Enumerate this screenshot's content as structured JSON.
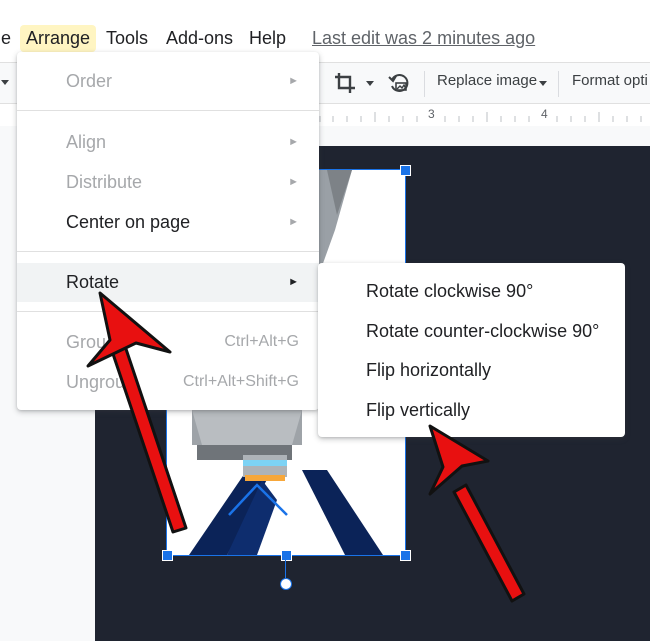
{
  "menubar": {
    "partial_item": "e",
    "items": [
      "Arrange",
      "Tools",
      "Add-ons",
      "Help"
    ],
    "last_edit": "Last edit was 2 minutes ago"
  },
  "toolbar": {
    "replace_image": "Replace image",
    "format_options": "Format opti"
  },
  "ruler": {
    "marks": [
      "3",
      "4"
    ]
  },
  "arrange_menu": {
    "order": "Order",
    "align": "Align",
    "distribute": "Distribute",
    "center_on_page": "Center on page",
    "rotate": "Rotate",
    "group": "Grou",
    "group_shortcut": "Ctrl+Alt+G",
    "ungroup": "Ungrou",
    "ungroup_shortcut": "Ctrl+Alt+Shift+G",
    "submenu_arrow": "►"
  },
  "rotate_submenu": {
    "items": [
      "Rotate clockwise 90°",
      "Rotate counter-clockwise 90°",
      "Flip horizontally",
      "Flip vertically"
    ]
  },
  "colors": {
    "highlight_menu": "#fff5c2",
    "selection": "#1a73e8",
    "slide_background": "#1f2430",
    "annotation_arrow": "#e81010"
  }
}
